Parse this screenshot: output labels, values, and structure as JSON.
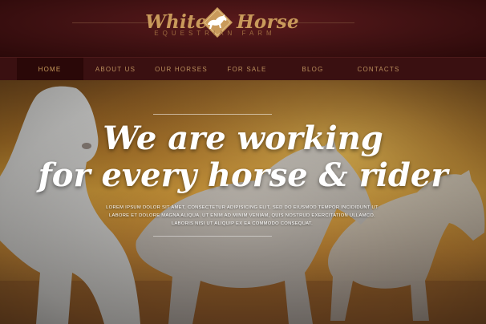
{
  "brand": {
    "name_left": "White",
    "name_right": "Horse",
    "tagline": "EQUESTRIAN FARM",
    "badge_icon": "horse-diamond-icon"
  },
  "nav": {
    "items": [
      {
        "label": "HOME",
        "active": true
      },
      {
        "label": "ABOUT US",
        "active": false
      },
      {
        "label": "OUR HORSES",
        "active": false
      },
      {
        "label": "FOR SALE",
        "active": false
      },
      {
        "label": "BLOG",
        "active": false
      },
      {
        "label": "CONTACTS",
        "active": false
      }
    ]
  },
  "hero": {
    "title_line1": "We are working",
    "title_line2": "for every horse & rider",
    "text": "Lorem ipsum dolor sit amet, consectetur adipisicing elit, sed do eiusmod tempor incididunt ut labore et dolore magna aliqua. Ut enim ad minim veniam, quis nostrud exercitation ullamco. laboris nisi ut aliquip ex ea commodo consequat."
  },
  "colors": {
    "header_bg": "#3f1112",
    "nav_bg": "#3a1011",
    "accent_gold": "#c99a5b",
    "nav_active_bg": "#2a0808",
    "hero_text": "#ffffff"
  }
}
